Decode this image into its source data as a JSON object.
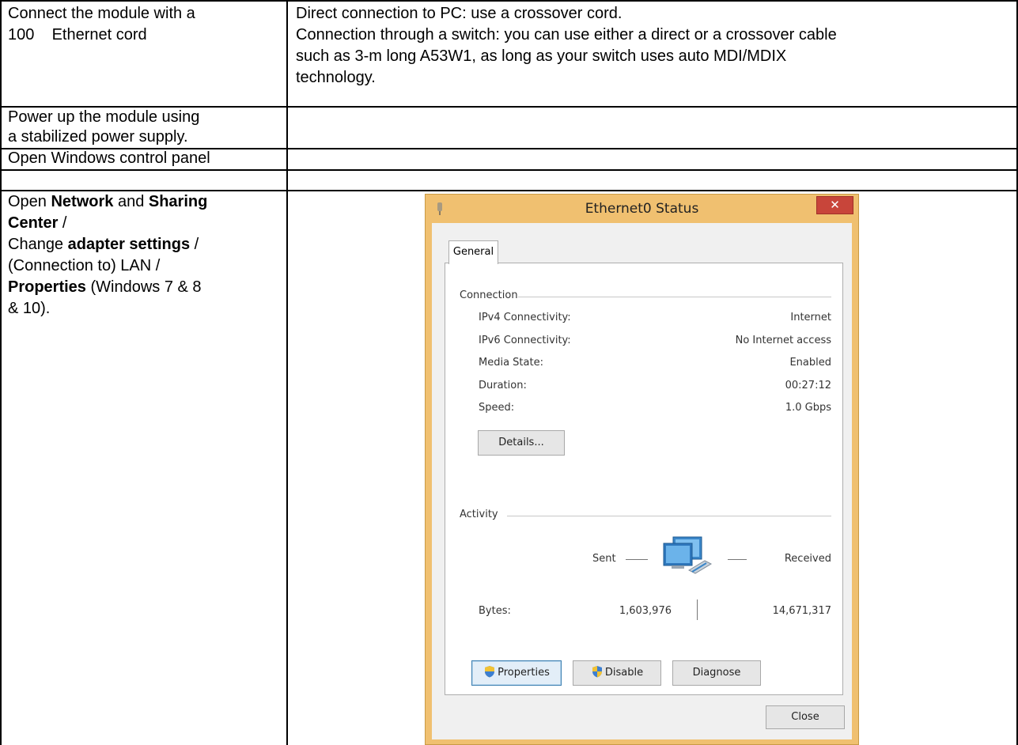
{
  "table": {
    "rows": [
      {
        "step": [
          "Connect the module with a",
          "100    Ethernet cord"
        ],
        "detail": [
          "Direct connection to PC: use a crossover cord.",
          "Connection through a switch: you can use either a direct or a crossover cable",
          "such as 3-m long A53W1, as long as your switch uses auto MDI/MDIX",
          "technology."
        ]
      },
      {
        "step": [
          "Power up the module using",
          "a stabilized power supply."
        ]
      },
      {
        "step": [
          "Open Windows control panel"
        ]
      },
      {
        "step_rich": {
          "l1a": "Open ",
          "l1b": "Network",
          "l1c": " and ",
          "l1d": "Sharing",
          "l2a": "Center",
          "l2b": " /",
          "l3a": "Change ",
          "l3b": "adapter settings",
          "l3c": " /",
          "l4": "(Connection to) LAN  /",
          "l5a": "Properties",
          "l5b": " (Windows 7 & 8",
          "l6": "& 10)."
        }
      }
    ]
  },
  "dialog": {
    "title": "Ethernet0 Status",
    "close_glyph": "✕",
    "tab_general": "General",
    "connection_group": "Connection",
    "rows": [
      {
        "label": "IPv4 Connectivity:",
        "value": "Internet"
      },
      {
        "label": "IPv6 Connectivity:",
        "value": "No Internet access"
      },
      {
        "label": "Media State:",
        "value": "Enabled"
      },
      {
        "label": "Duration:",
        "value": "00:27:12"
      },
      {
        "label": "Speed:",
        "value": "1.0 Gbps"
      }
    ],
    "details_button": "Details...",
    "activity_group": "Activity",
    "sent_label": "Sent",
    "received_label": "Received",
    "bytes_label": "Bytes:",
    "bytes_sent": "1,603,976",
    "bytes_received": "14,671,317",
    "properties_button": "Properties",
    "disable_button": "Disable",
    "diagnose_button": "Diagnose",
    "close_button": "Close",
    "icons": {
      "network": "network-computers-icon",
      "shield": "uac-shield-icon",
      "title_icon": "network-adapter-icon"
    }
  }
}
